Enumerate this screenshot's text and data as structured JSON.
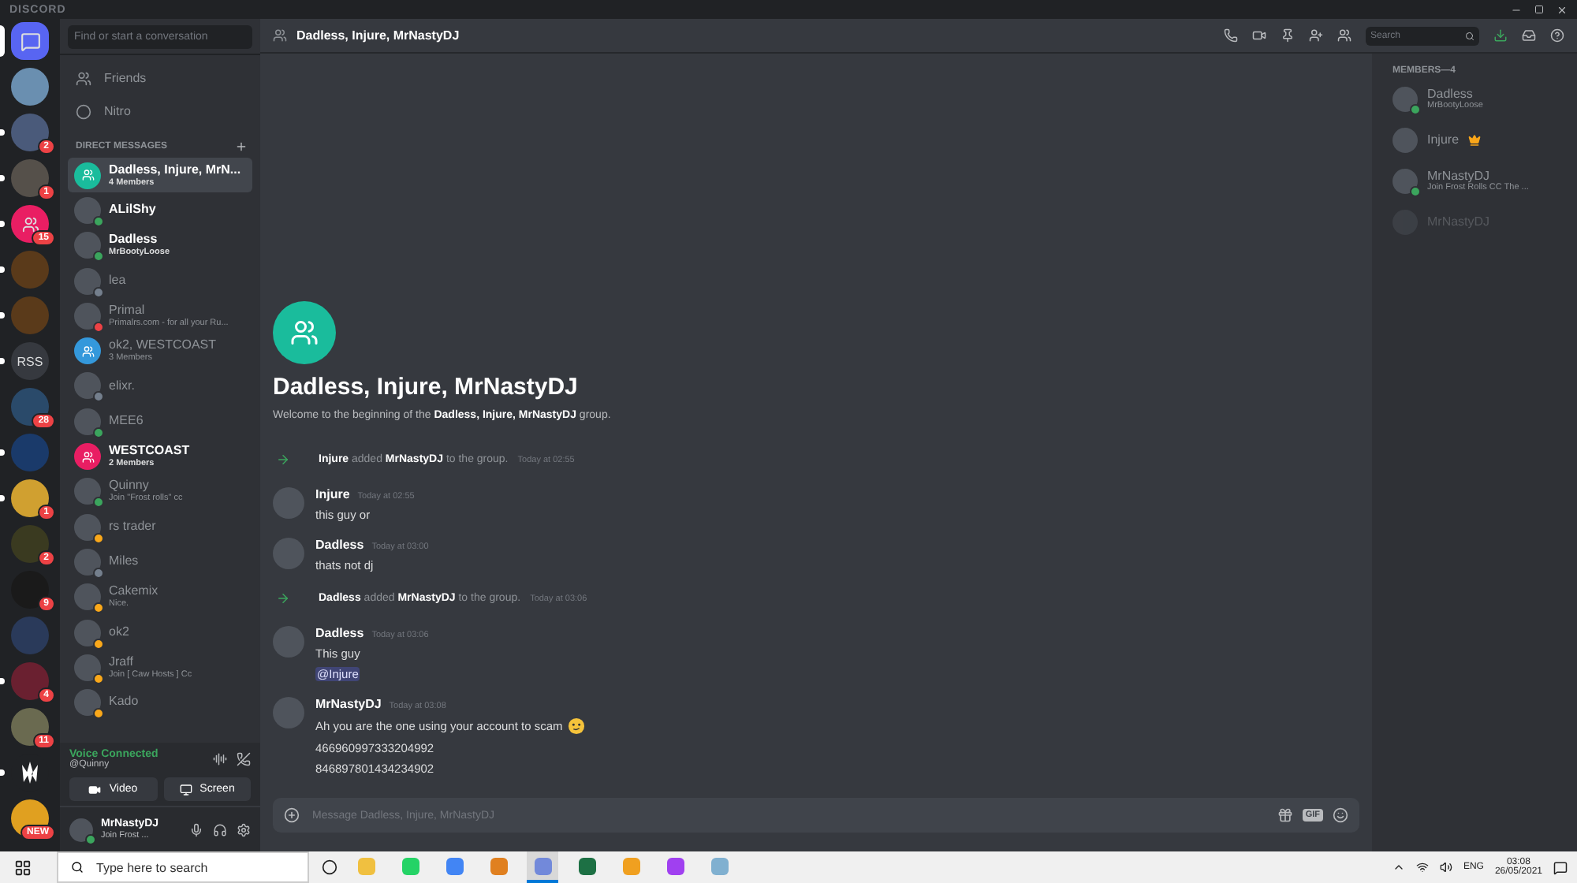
{
  "window": {
    "title": "DISCORD"
  },
  "servers": [
    {
      "kind": "home",
      "selected": true,
      "unread": false,
      "color": "#5865f2"
    },
    {
      "kind": "avatar",
      "selected": false,
      "unread": false,
      "color": "#6a8fb0"
    },
    {
      "kind": "avatar",
      "selected": false,
      "unread": true,
      "color": "#4a5a7a",
      "badge": "2"
    },
    {
      "kind": "avatar",
      "selected": false,
      "unread": true,
      "color": "#55504a",
      "badge": "1"
    },
    {
      "kind": "group",
      "selected": false,
      "unread": true,
      "color": "#e91e63",
      "badge": "15"
    },
    {
      "kind": "avatar",
      "selected": false,
      "unread": true,
      "color": "#5a3a1a"
    },
    {
      "kind": "avatar",
      "selected": false,
      "unread": true,
      "color": "#5a3a1a"
    },
    {
      "kind": "text",
      "selected": false,
      "unread": true,
      "color": "#36393f",
      "label": "RSS"
    },
    {
      "kind": "avatar",
      "selected": false,
      "unread": false,
      "color": "#2a4a6a",
      "badge": "28"
    },
    {
      "kind": "avatar",
      "selected": false,
      "unread": true,
      "color": "#1a3a6a"
    },
    {
      "kind": "avatar",
      "selected": false,
      "unread": true,
      "color": "#d0a030",
      "badge": "1"
    },
    {
      "kind": "avatar",
      "selected": false,
      "unread": false,
      "color": "#3a3a20",
      "badge": "2"
    },
    {
      "kind": "avatar",
      "selected": false,
      "unread": false,
      "color": "#1a1a1a",
      "badge": "9"
    },
    {
      "kind": "avatar",
      "selected": false,
      "unread": false,
      "color": "#2a3a5a"
    },
    {
      "kind": "avatar",
      "selected": false,
      "unread": true,
      "color": "#6a2030",
      "badge": "4"
    },
    {
      "kind": "avatar",
      "selected": false,
      "unread": false,
      "color": "#6a6a50",
      "badge": "11"
    },
    {
      "kind": "logo",
      "selected": false,
      "unread": true,
      "color": "#202225"
    },
    {
      "kind": "avatar",
      "selected": false,
      "unread": false,
      "color": "#e0a020",
      "badge": "NEW"
    }
  ],
  "dms": {
    "search": {
      "placeholder": "Find or start a conversation"
    },
    "nav": [
      {
        "label": "Friends",
        "kind": "friends"
      },
      {
        "label": "Nitro",
        "kind": "nitro"
      }
    ],
    "heading": "DIRECT MESSAGES",
    "items": [
      {
        "kind": "group",
        "name": "Dadless, Injure, MrN...",
        "subtitle": "4 Members",
        "selected": true,
        "unread": true,
        "color": "#1abc9c"
      },
      {
        "kind": "user",
        "name": "ALilShy",
        "selected": false,
        "unread": true,
        "status": {
          "color": "#3ba55d"
        }
      },
      {
        "kind": "user",
        "name": "Dadless",
        "subtitle": "MrBootyLoose",
        "selected": false,
        "unread": true,
        "status": {
          "color": "#3ba55d"
        }
      },
      {
        "kind": "user",
        "name": "lea",
        "selected": false,
        "unread": false,
        "status": {
          "color": "#747f8d"
        }
      },
      {
        "kind": "user",
        "name": "Primal",
        "subtitle": "Primalrs.com - for all your Ru...",
        "selected": false,
        "unread": false,
        "status": {
          "color": "#ed4245"
        }
      },
      {
        "kind": "group",
        "name": "ok2, WESTCOAST",
        "subtitle": "3 Members",
        "selected": false,
        "unread": false,
        "color": "#3498db"
      },
      {
        "kind": "user",
        "name": "elixr.",
        "selected": false,
        "unread": false,
        "status": {
          "color": "#747f8d"
        }
      },
      {
        "kind": "user",
        "name": "MEE6",
        "selected": false,
        "unread": false,
        "status": {
          "color": "#3ba55d"
        }
      },
      {
        "kind": "group",
        "name": "WESTCOAST",
        "subtitle": "2 Members",
        "selected": false,
        "unread": true,
        "color": "#e91e63"
      },
      {
        "kind": "user",
        "name": "Quinny",
        "subtitle": "Join \"Frost rolls\" cc",
        "selected": false,
        "unread": false,
        "status": {
          "color": "#3ba55d"
        }
      },
      {
        "kind": "user",
        "name": "rs trader",
        "selected": false,
        "unread": false,
        "status": {
          "color": "#faa81a"
        }
      },
      {
        "kind": "user",
        "name": "Miles",
        "selected": false,
        "unread": false,
        "status": {
          "color": "#747f8d"
        }
      },
      {
        "kind": "user",
        "name": "Cakemix",
        "subtitle": "Nice.",
        "selected": false,
        "unread": false,
        "status": {
          "color": "#faa81a"
        }
      },
      {
        "kind": "user",
        "name": "ok2",
        "selected": false,
        "unread": false,
        "status": {
          "color": "#faa81a"
        }
      },
      {
        "kind": "user",
        "name": "Jraff",
        "subtitle": "Join [ Caw Hosts ] Cc",
        "selected": false,
        "unread": false,
        "status": {
          "color": "#faa81a"
        }
      },
      {
        "kind": "user",
        "name": "Kado",
        "selected": false,
        "unread": false,
        "status": {
          "color": "#faa81a"
        }
      }
    ]
  },
  "voice": {
    "status": "Voice Connected",
    "channel": "@Quinny",
    "buttons": [
      {
        "label": "Video",
        "kind": "video"
      },
      {
        "label": "Screen",
        "kind": "screen"
      }
    ]
  },
  "user": {
    "name": "MrNastyDJ",
    "activity": "Join Frost ...",
    "status": {
      "color": "#3ba55d"
    }
  },
  "chat": {
    "title": "Dadless, Injure, MrNastyDJ",
    "search": {
      "placeholder": "Search"
    },
    "intro": {
      "title": "Dadless, Injure, MrNastyDJ",
      "text": "Welcome to the beginning of the **Dadless, Injure, MrNastyDJ** group."
    },
    "messages": [
      {
        "kind": "system",
        "text": "**Injure** added **MrNastyDJ** to the group.",
        "time": "Today at 02:55"
      },
      {
        "kind": "message",
        "author": "Injure",
        "time": "Today at 02:55",
        "lines": [
          {
            "text": "this guy or"
          }
        ]
      },
      {
        "kind": "message",
        "author": "Dadless",
        "time": "Today at 03:00",
        "lines": [
          {
            "text": "thats not dj"
          }
        ]
      },
      {
        "kind": "system",
        "text": "**Dadless** added **MrNastyDJ** to the group.",
        "time": "Today at 03:06"
      },
      {
        "kind": "message",
        "author": "Dadless",
        "time": "Today at 03:06",
        "lines": [
          {
            "text": "This guy"
          },
          {
            "text": "@Injure",
            "mention": true
          }
        ]
      },
      {
        "kind": "message",
        "author": "MrNastyDJ",
        "time": "Today at 03:08",
        "lines": [
          {
            "text": "Ah you are the one using your account to scam",
            "emoji": true
          },
          {
            "text": "466960997333204992"
          },
          {
            "text": "846897801434234902"
          }
        ]
      }
    ],
    "input": {
      "placeholder": "Message Dadless, Injure, MrNastyDJ",
      "gif": "GIF"
    }
  },
  "members": {
    "heading": "MEMBERS—4",
    "items": [
      {
        "name": "Dadless",
        "subtitle": "MrBootyLoose",
        "status": {
          "color": "#3ba55d"
        },
        "offline": false,
        "owner": false
      },
      {
        "name": "Injure",
        "offline": false,
        "owner": true
      },
      {
        "name": "MrNastyDJ",
        "subtitle": "Join Frost Rolls CC The ...",
        "status": {
          "color": "#3ba55d"
        },
        "offline": false,
        "owner": false
      },
      {
        "name": "MrNastyDJ",
        "offline": true,
        "owner": false
      }
    ]
  },
  "taskbar": {
    "search": {
      "placeholder": "Type here to search"
    },
    "apps": [
      {
        "color": "#f0c040",
        "selected": false
      },
      {
        "color": "#25d366",
        "selected": false
      },
      {
        "color": "#4285f4",
        "selected": false
      },
      {
        "color": "#e08020",
        "selected": false
      },
      {
        "color": "#7289da",
        "selected": true
      },
      {
        "color": "#1d7044",
        "selected": false
      },
      {
        "color": "#f0a020",
        "selected": false
      },
      {
        "color": "#a040f0",
        "selected": false
      },
      {
        "color": "#80b0d0",
        "selected": false
      }
    ],
    "language": "ENG",
    "time": "03:08",
    "date": "26/05/2021"
  }
}
